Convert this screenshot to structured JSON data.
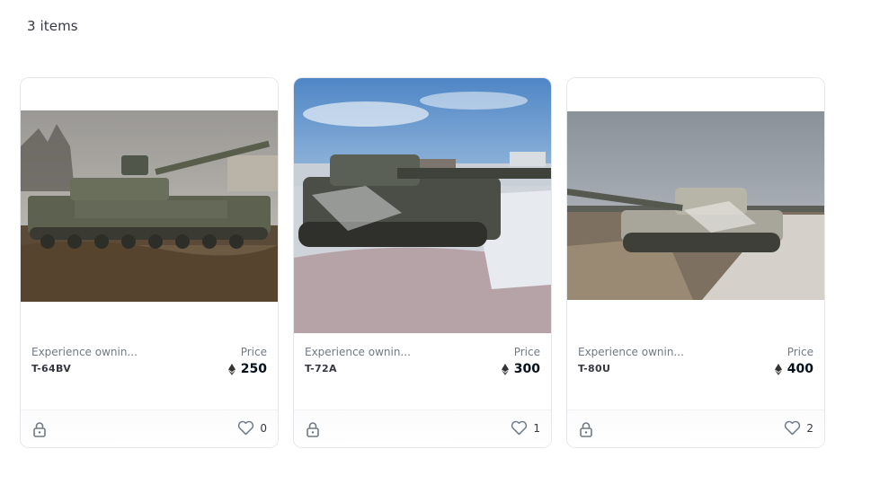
{
  "results": {
    "count_label": "3 items"
  },
  "cards": [
    {
      "description": "Experience ownin...",
      "name": "T-64BV",
      "price_label": "Price",
      "price": "250",
      "favorites": "0",
      "image_alt": "Tank in muddy field"
    },
    {
      "description": "Experience ownin...",
      "name": "T-72A",
      "price_label": "Price",
      "price": "300",
      "favorites": "1",
      "image_alt": "Tank stuck in snowy ditch"
    },
    {
      "description": "Experience ownin...",
      "name": "T-80U",
      "price_label": "Price",
      "price": "400",
      "favorites": "2",
      "image_alt": "Tank on dirt road"
    }
  ],
  "icons": {
    "currency": "ethereum-icon",
    "favorite": "heart-icon",
    "status": "lock-icon"
  },
  "colors": {
    "text_primary": "#04111d",
    "text_secondary": "#707a83",
    "border": "#e5e8eb"
  }
}
